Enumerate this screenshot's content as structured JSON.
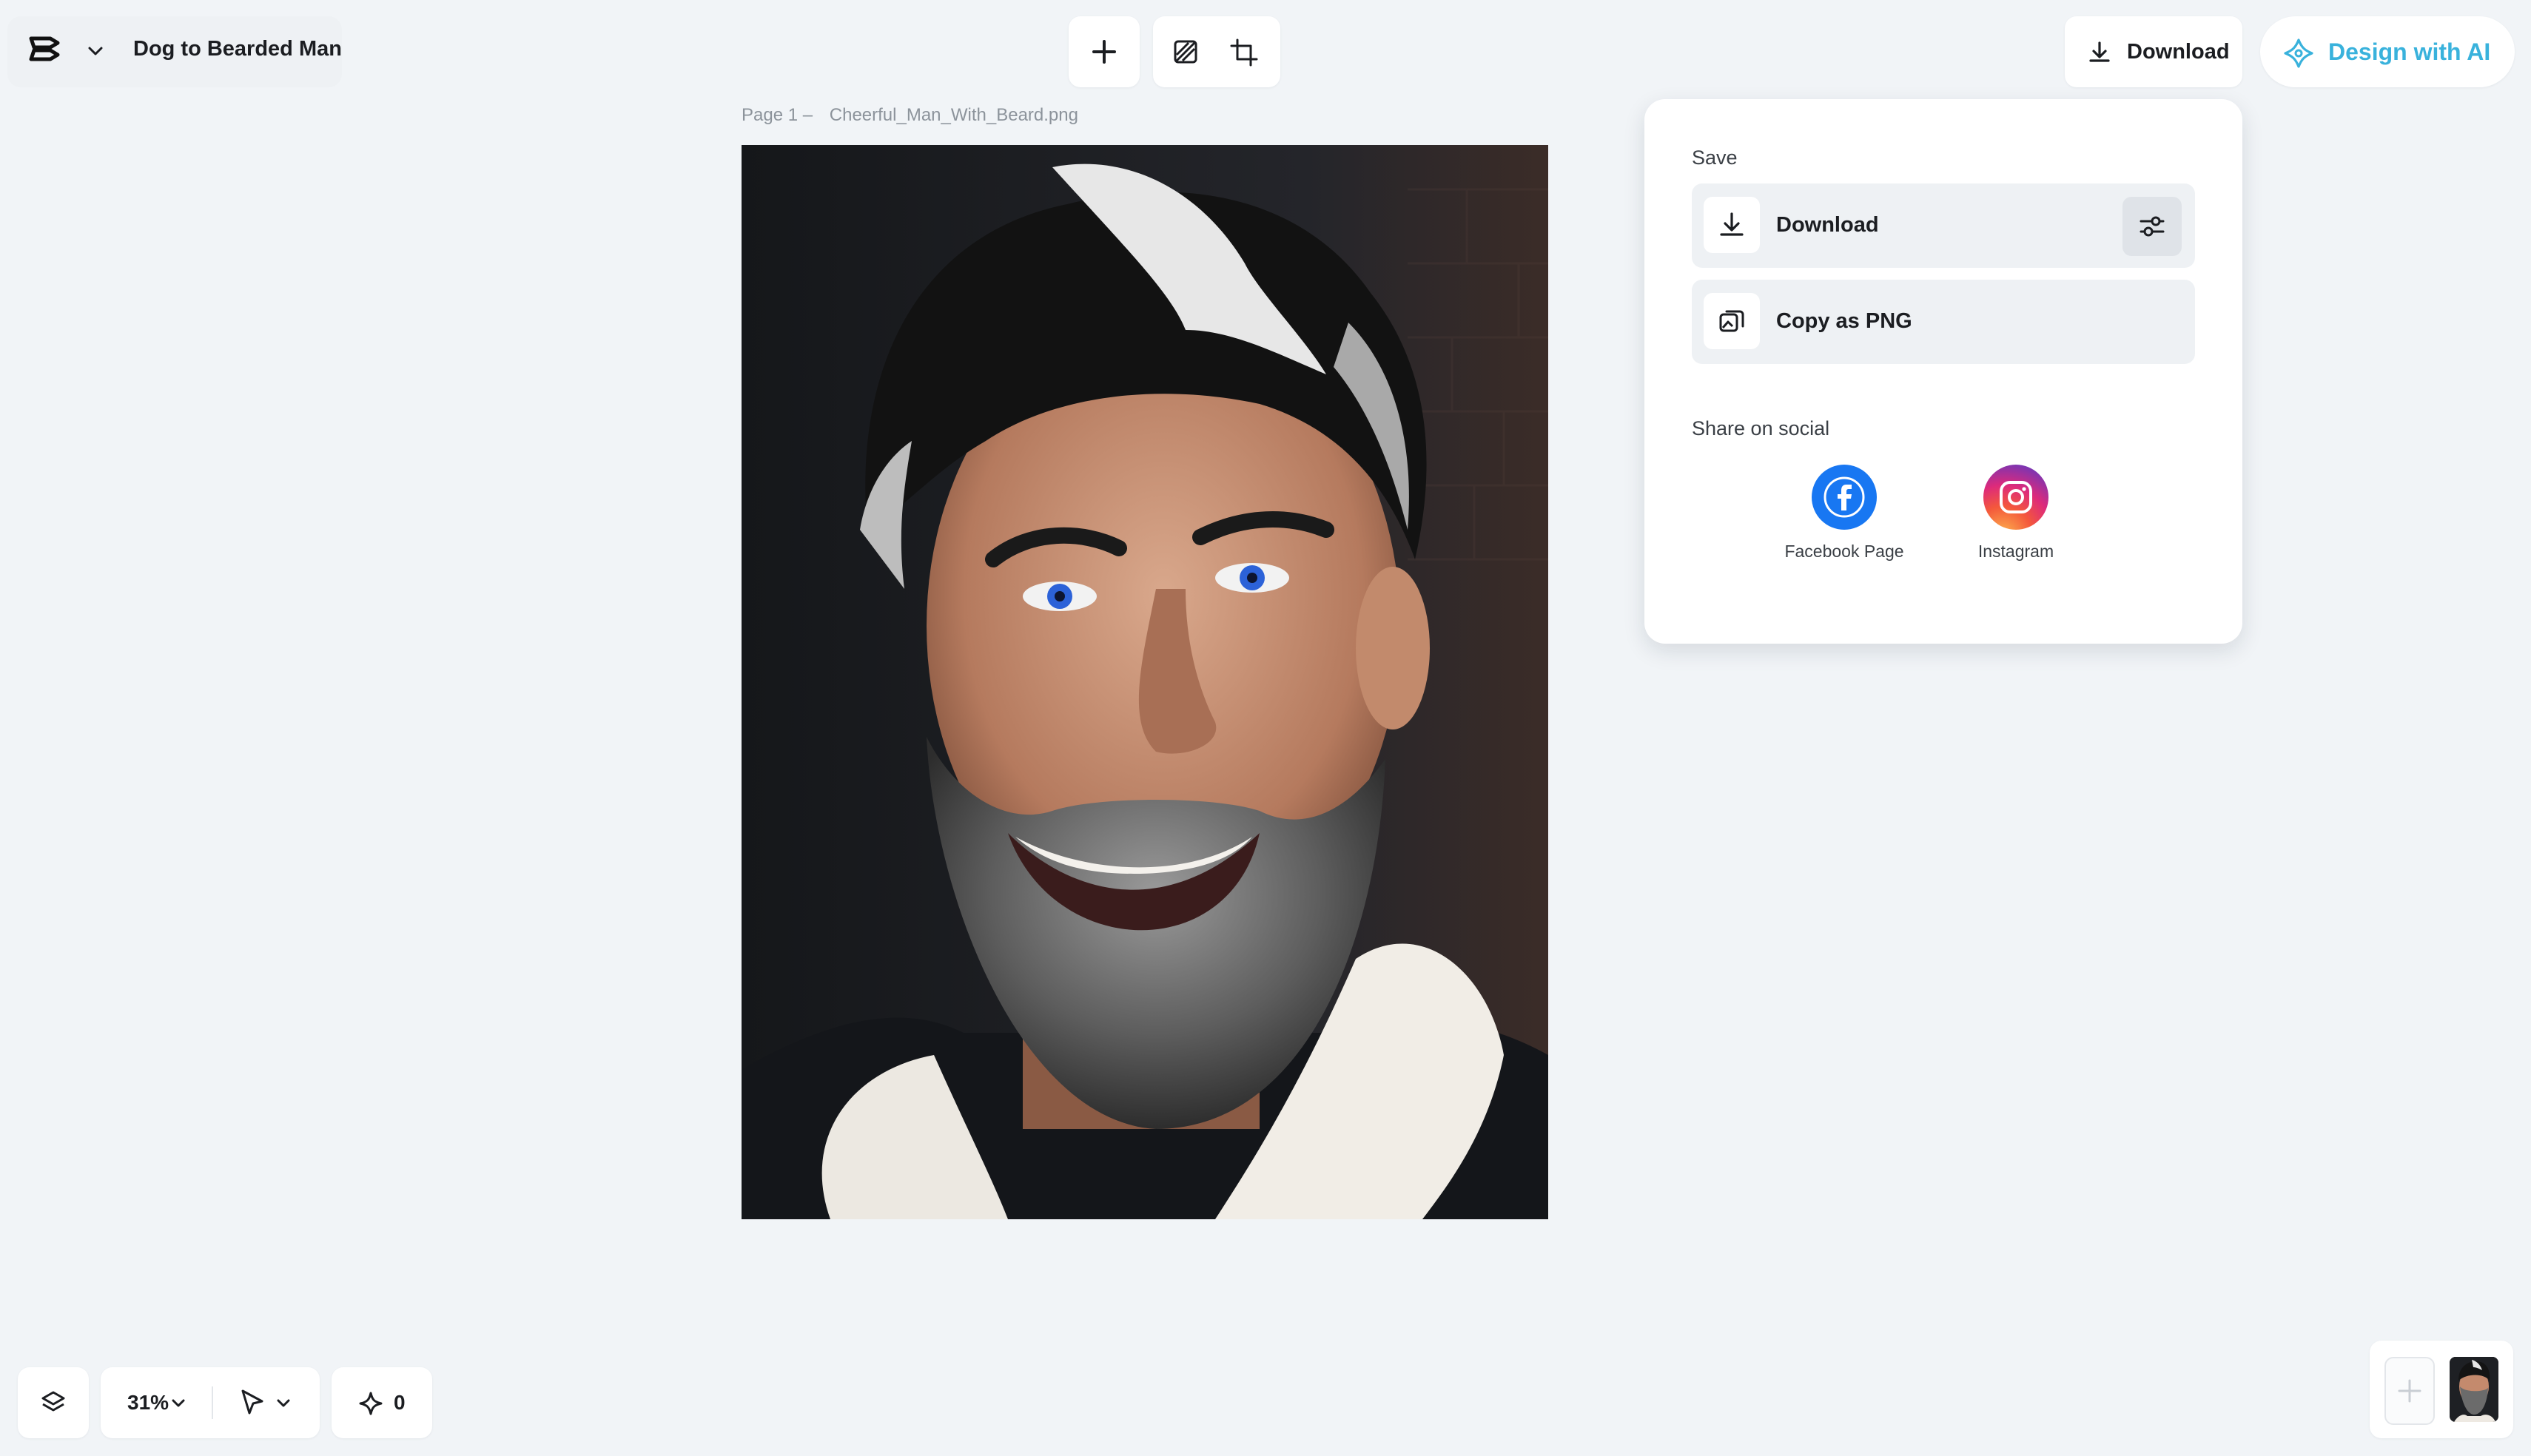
{
  "project": {
    "title": "Dog to Bearded Man"
  },
  "toolbar": {
    "add_icon": "plus-icon",
    "tools": [
      "hatch-square-icon",
      "crop-icon"
    ]
  },
  "header": {
    "download_label": "Download",
    "design_ai_label": "Design with AI",
    "accent_color": "#39b2dc"
  },
  "canvas": {
    "page_label": "Page 1 –",
    "file_name": "Cheerful_Man_With_Beard.png"
  },
  "download_panel": {
    "save_title": "Save",
    "download_label": "Download",
    "copy_label": "Copy as PNG",
    "share_title": "Share on social",
    "social": [
      {
        "name": "Facebook Page",
        "color": "#1877f2"
      },
      {
        "name": "Instagram",
        "color": "#dd2a7b"
      }
    ]
  },
  "bottom": {
    "zoom_value": "31%",
    "credits_value": "0"
  }
}
